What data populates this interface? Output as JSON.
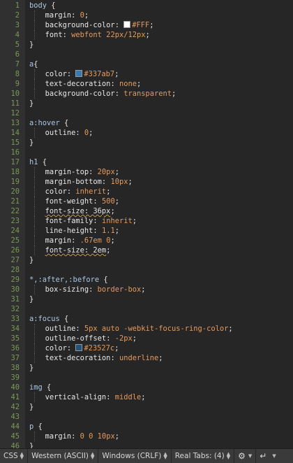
{
  "editor": {
    "lines": [
      {
        "n": "1",
        "t": [
          [
            "sel",
            "body"
          ],
          [
            "punc",
            " {"
          ]
        ]
      },
      {
        "n": "2",
        "i": 1,
        "t": [
          [
            "prop",
            "margin"
          ],
          [
            "punc",
            ": "
          ],
          [
            "num",
            "0"
          ],
          [
            "punc",
            ";"
          ]
        ]
      },
      {
        "n": "3",
        "i": 1,
        "t": [
          [
            "prop",
            "background-color"
          ],
          [
            "punc",
            ": "
          ],
          [
            "swatch",
            "#FFFFFF"
          ],
          [
            "val",
            "#FFF"
          ],
          [
            "punc",
            ";"
          ]
        ]
      },
      {
        "n": "4",
        "i": 1,
        "t": [
          [
            "prop",
            "font"
          ],
          [
            "punc",
            ": "
          ],
          [
            "val",
            "webfont 22px/12px"
          ],
          [
            "punc",
            ";"
          ]
        ]
      },
      {
        "n": "5",
        "t": [
          [
            "punc",
            "}"
          ]
        ]
      },
      {
        "n": "6",
        "t": []
      },
      {
        "n": "7",
        "t": [
          [
            "sel",
            "a"
          ],
          [
            "punc",
            "{"
          ]
        ]
      },
      {
        "n": "8",
        "i": 1,
        "t": [
          [
            "prop",
            "color"
          ],
          [
            "punc",
            ": "
          ],
          [
            "swatch",
            "#337ab7"
          ],
          [
            "val",
            "#337ab7"
          ],
          [
            "punc",
            ";"
          ]
        ]
      },
      {
        "n": "9",
        "i": 1,
        "t": [
          [
            "prop",
            "text-decoration"
          ],
          [
            "punc",
            ": "
          ],
          [
            "val",
            "none"
          ],
          [
            "punc",
            ";"
          ]
        ]
      },
      {
        "n": "10",
        "i": 1,
        "t": [
          [
            "prop",
            "background-color"
          ],
          [
            "punc",
            ": "
          ],
          [
            "val",
            "transparent"
          ],
          [
            "punc",
            ";"
          ]
        ]
      },
      {
        "n": "11",
        "t": [
          [
            "punc",
            "}"
          ]
        ]
      },
      {
        "n": "12",
        "t": []
      },
      {
        "n": "13",
        "t": [
          [
            "sel",
            "a:hover"
          ],
          [
            "punc",
            " {"
          ]
        ]
      },
      {
        "n": "14",
        "i": 1,
        "t": [
          [
            "prop",
            "outline"
          ],
          [
            "punc",
            ": "
          ],
          [
            "num",
            "0"
          ],
          [
            "punc",
            ";"
          ]
        ]
      },
      {
        "n": "15",
        "t": [
          [
            "punc",
            "}"
          ]
        ]
      },
      {
        "n": "16",
        "t": []
      },
      {
        "n": "17",
        "t": [
          [
            "sel",
            "h1"
          ],
          [
            "punc",
            " {"
          ]
        ]
      },
      {
        "n": "18",
        "i": 1,
        "t": [
          [
            "prop",
            "margin-top"
          ],
          [
            "punc",
            ": "
          ],
          [
            "num",
            "20px"
          ],
          [
            "punc",
            ";"
          ]
        ]
      },
      {
        "n": "19",
        "i": 1,
        "t": [
          [
            "prop",
            "margin-bottom"
          ],
          [
            "punc",
            ": "
          ],
          [
            "num",
            "10px"
          ],
          [
            "punc",
            ";"
          ]
        ]
      },
      {
        "n": "20",
        "i": 1,
        "t": [
          [
            "prop",
            "color"
          ],
          [
            "punc",
            ": "
          ],
          [
            "val",
            "inherit"
          ],
          [
            "punc",
            ";"
          ]
        ]
      },
      {
        "n": "21",
        "i": 1,
        "t": [
          [
            "prop",
            "font-weight"
          ],
          [
            "punc",
            ": "
          ],
          [
            "num",
            "500"
          ],
          [
            "punc",
            ";"
          ]
        ]
      },
      {
        "n": "22",
        "i": 1,
        "t": [
          [
            "squig",
            "font-size: 36px"
          ],
          [
            "punc",
            ";"
          ]
        ]
      },
      {
        "n": "23",
        "i": 1,
        "t": [
          [
            "prop",
            "font-family"
          ],
          [
            "punc",
            ": "
          ],
          [
            "val",
            "inherit"
          ],
          [
            "punc",
            ";"
          ]
        ]
      },
      {
        "n": "24",
        "i": 1,
        "t": [
          [
            "prop",
            "line-height"
          ],
          [
            "punc",
            ": "
          ],
          [
            "num",
            "1.1"
          ],
          [
            "punc",
            ";"
          ]
        ]
      },
      {
        "n": "25",
        "i": 1,
        "t": [
          [
            "prop",
            "margin"
          ],
          [
            "punc",
            ": "
          ],
          [
            "num",
            ".67em 0"
          ],
          [
            "punc",
            ";"
          ]
        ]
      },
      {
        "n": "26",
        "i": 1,
        "t": [
          [
            "squig",
            "font-size: 2em"
          ],
          [
            "punc",
            ";"
          ]
        ]
      },
      {
        "n": "27",
        "t": [
          [
            "punc",
            "}"
          ]
        ]
      },
      {
        "n": "28",
        "t": []
      },
      {
        "n": "29",
        "t": [
          [
            "sel",
            "*,:after,:before"
          ],
          [
            "punc",
            " {"
          ]
        ]
      },
      {
        "n": "30",
        "i": 1,
        "t": [
          [
            "prop",
            "box-sizing"
          ],
          [
            "punc",
            ": "
          ],
          [
            "val",
            "border-box"
          ],
          [
            "punc",
            ";"
          ]
        ]
      },
      {
        "n": "31",
        "t": [
          [
            "punc",
            "}"
          ]
        ]
      },
      {
        "n": "32",
        "t": []
      },
      {
        "n": "33",
        "t": [
          [
            "sel",
            "a:focus"
          ],
          [
            "punc",
            " {"
          ]
        ]
      },
      {
        "n": "34",
        "i": 1,
        "t": [
          [
            "prop",
            "outline"
          ],
          [
            "punc",
            ": "
          ],
          [
            "val",
            "5px auto -webkit-focus-ring-color"
          ],
          [
            "punc",
            ";"
          ]
        ]
      },
      {
        "n": "35",
        "i": 1,
        "t": [
          [
            "prop",
            "outline-offset"
          ],
          [
            "punc",
            ": "
          ],
          [
            "num",
            "-2px"
          ],
          [
            "punc",
            ";"
          ]
        ]
      },
      {
        "n": "36",
        "i": 1,
        "t": [
          [
            "prop",
            "color"
          ],
          [
            "punc",
            ": "
          ],
          [
            "swatch",
            "#23527c"
          ],
          [
            "val",
            "#23527c"
          ],
          [
            "punc",
            ";"
          ]
        ]
      },
      {
        "n": "37",
        "i": 1,
        "t": [
          [
            "prop",
            "text-decoration"
          ],
          [
            "punc",
            ": "
          ],
          [
            "val",
            "underline"
          ],
          [
            "punc",
            ";"
          ]
        ]
      },
      {
        "n": "38",
        "t": [
          [
            "punc",
            "}"
          ]
        ]
      },
      {
        "n": "39",
        "t": []
      },
      {
        "n": "40",
        "t": [
          [
            "sel",
            "img"
          ],
          [
            "punc",
            " {"
          ]
        ]
      },
      {
        "n": "41",
        "i": 1,
        "t": [
          [
            "prop",
            "vertical-align"
          ],
          [
            "punc",
            ": "
          ],
          [
            "val",
            "middle"
          ],
          [
            "punc",
            ";"
          ]
        ]
      },
      {
        "n": "42",
        "t": [
          [
            "punc",
            "}"
          ]
        ]
      },
      {
        "n": "43",
        "t": []
      },
      {
        "n": "44",
        "t": [
          [
            "sel",
            "p"
          ],
          [
            "punc",
            " {"
          ]
        ]
      },
      {
        "n": "45",
        "i": 1,
        "t": [
          [
            "prop",
            "margin"
          ],
          [
            "punc",
            ": "
          ],
          [
            "num",
            "0 0 10px"
          ],
          [
            "punc",
            ";"
          ]
        ]
      },
      {
        "n": "46",
        "t": [
          [
            "punc",
            "}"
          ]
        ]
      }
    ]
  },
  "statusbar": {
    "language": "CSS",
    "encoding": "Western (ASCII)",
    "line_endings": "Windows (CRLF)",
    "tabs": "Real Tabs: (4)",
    "settings_icon": "gear-icon",
    "return_icon": "return-icon"
  }
}
